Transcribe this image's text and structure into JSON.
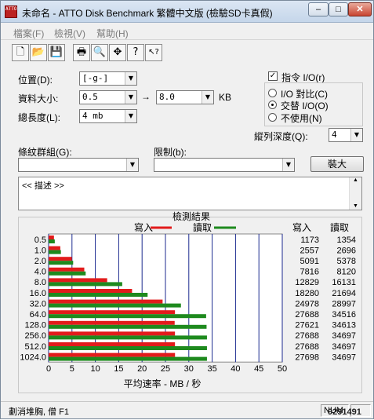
{
  "window": {
    "title": "未命名 - ATTO Disk Benchmark  繁體中文版 (檢驗SD卡真假)",
    "icon_text": "ATTO",
    "controls": {
      "minimize": "–",
      "maximize": "□",
      "close": "✕"
    }
  },
  "menu": [
    {
      "label": "檔案(F)"
    },
    {
      "label": "檢視(V)"
    },
    {
      "label": "幫助(H)"
    }
  ],
  "toolbar": [
    {
      "icon": "new-document-icon",
      "glyph": "🗋"
    },
    {
      "icon": "open-folder-icon",
      "glyph": "📂"
    },
    {
      "icon": "save-icon",
      "glyph": "💾"
    },
    {
      "icon": "print-icon",
      "glyph": "🖶"
    },
    {
      "icon": "print-preview-icon",
      "glyph": "🔍"
    },
    {
      "icon": "move-icon",
      "glyph": "✥"
    },
    {
      "icon": "help-icon",
      "glyph": "?"
    },
    {
      "icon": "context-help-icon",
      "glyph": "↖?"
    }
  ],
  "settings": {
    "drive_label": "位置(D):",
    "drive_value": "[-g-]",
    "size_label": "資料大小:",
    "size_from": "0.5",
    "size_arrow": "→",
    "size_to": "8.0",
    "size_unit": "KB",
    "length_label": "總長度(L):",
    "length_value": "4 mb",
    "direct_io_label": "指令 I/O(r)",
    "direct_io_checked": "✓",
    "io_compare_label": "I/O 對比(C)",
    "overlapped_io_label": "交替 I/O(O)",
    "neither_label": "不使用(N)",
    "queue_depth_label": "縱列深度(Q):",
    "queue_depth_value": "4",
    "pattern_label": "條紋群組(G):",
    "pattern_value": "",
    "restrict_label": "限制(b):",
    "restrict_value": "",
    "start_button": "裝大"
  },
  "description": {
    "text": "<< 描述 >>"
  },
  "results": {
    "title": "檢測結果",
    "legend_write": "寫入",
    "legend_read": "讀取",
    "col_write": "寫入",
    "col_read": "讀取",
    "write_color": "#e21b1b",
    "read_color": "#1e8a1e",
    "grid_color": "#1c2a8f"
  },
  "chart_data": {
    "type": "bar",
    "orientation": "horizontal",
    "categories": [
      "0.5",
      "1.0",
      "2.0",
      "4.0",
      "8.0",
      "16.0",
      "32.0",
      "64.0",
      "128.0",
      "256.0",
      "512.0",
      "1024.0"
    ],
    "series": [
      {
        "name": "寫入",
        "values_kb": [
          1173,
          2557,
          5091,
          7816,
          12829,
          18280,
          24978,
          27688,
          27621,
          27688,
          27688,
          27698
        ]
      },
      {
        "name": "讀取",
        "values_kb": [
          1354,
          2696,
          5378,
          8120,
          16131,
          21694,
          28997,
          34516,
          34613,
          34697,
          34697,
          34697
        ]
      }
    ],
    "xlabel": "平均速率 - MB / 秒",
    "xlim": [
      0,
      50
    ],
    "xticks": [
      "0",
      "5",
      "10",
      "15",
      "20",
      "25",
      "30",
      "35",
      "40",
      "45",
      "50"
    ]
  },
  "status": {
    "left": "劃消堆胸,    僧 F1",
    "num": "NUM",
    "watermark": "9291491"
  }
}
